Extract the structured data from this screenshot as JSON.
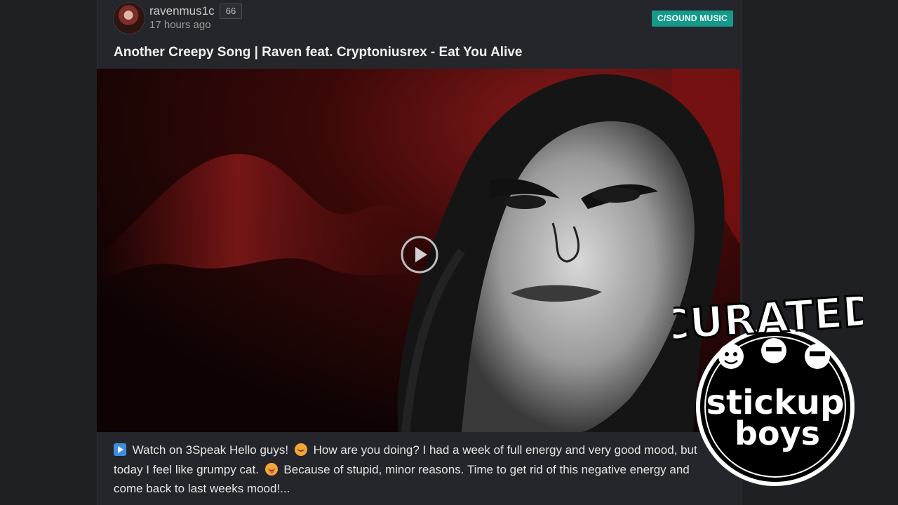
{
  "post": {
    "author": "ravenmus1c",
    "reputation": "66",
    "time_ago": "17 hours ago",
    "community": "C/SOUND MUSIC",
    "title": "Another Creepy Song | Raven feat. Cryptoniusrex - Eat You Alive",
    "desc_part1": "Watch on 3Speak Hello guys!",
    "desc_part2": "How are you doing? I had a week of full energy and very good mood, but today I feel like grumpy cat.",
    "desc_part3": "Because of stupid, minor reasons. Time to get rid of this negative energy and come back to last weeks mood!..."
  },
  "badge": {
    "top_text": "CURATED",
    "line1": "stickup",
    "line2": "boys"
  },
  "icons": {
    "play": "play-circle-icon",
    "watch": "play-box-icon",
    "emoji1": "smiling-face-icon",
    "emoji2": "tongue-face-icon"
  },
  "colors": {
    "community_badge": "#139a8a",
    "background": "#1f2024",
    "card": "#25262b"
  }
}
